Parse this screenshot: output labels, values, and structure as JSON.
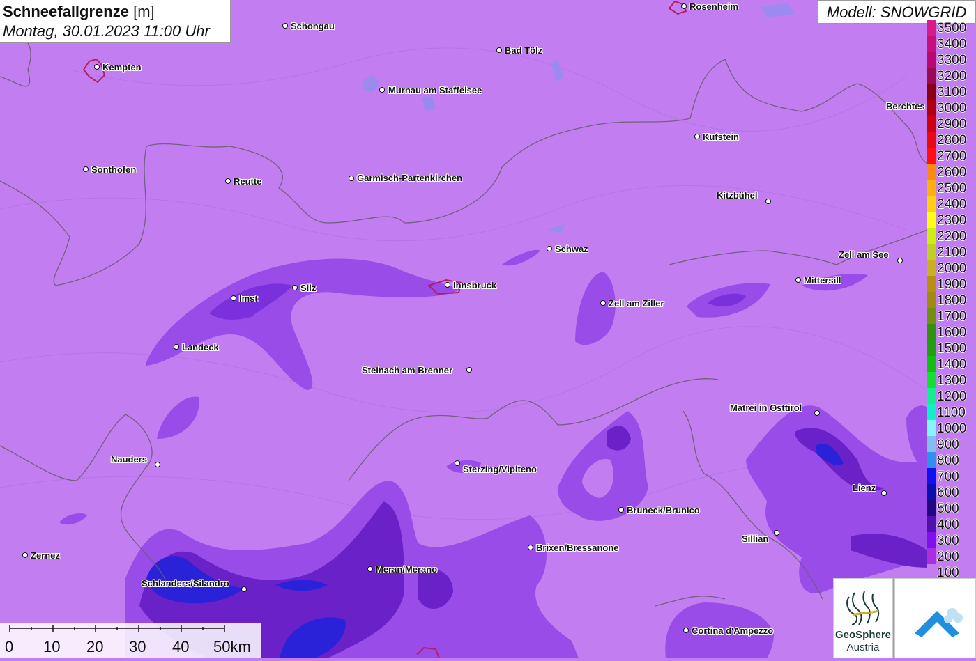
{
  "title": {
    "parameter": "Schneefallgrenze",
    "unit": "[m]",
    "datetime": "Montag, 30.01.2023 11:00 Uhr"
  },
  "model_label": "Modell: SNOWGRID",
  "cities": [
    {
      "name": "Rosenheim"
    },
    {
      "name": "Schongau"
    },
    {
      "name": "Kempten"
    },
    {
      "name": "Bad Tölz"
    },
    {
      "name": "Murnau am Staffelsee"
    },
    {
      "name": "Berchtes"
    },
    {
      "name": "Kufstein"
    },
    {
      "name": "Sonthofen"
    },
    {
      "name": "Reutte"
    },
    {
      "name": "Garmisch-Partenkirchen"
    },
    {
      "name": "Kitzbühel"
    },
    {
      "name": "Schwaz"
    },
    {
      "name": "Zell am See"
    },
    {
      "name": "Mittersill"
    },
    {
      "name": "Innsbruck"
    },
    {
      "name": "Imst"
    },
    {
      "name": "Silz"
    },
    {
      "name": "Zell am Ziller"
    },
    {
      "name": "Landeck"
    },
    {
      "name": "Steinach am Brenner"
    },
    {
      "name": "Matrei in Osttirol"
    },
    {
      "name": "Nauders"
    },
    {
      "name": "Sterzing/Vipiteno"
    },
    {
      "name": "Lienz"
    },
    {
      "name": "Bruneck/Brunico"
    },
    {
      "name": "Sillian"
    },
    {
      "name": "Brixen/Bressanone"
    },
    {
      "name": "Zernez"
    },
    {
      "name": "Meran/Merano"
    },
    {
      "name": "Schlanders/Silandro"
    },
    {
      "name": "Cortina d'Ampezzo"
    }
  ],
  "legend": [
    {
      "label": "3500",
      "color": "#d81b8a"
    },
    {
      "label": "3400",
      "color": "#c8107c"
    },
    {
      "label": "3300",
      "color": "#b80a6e"
    },
    {
      "label": "3200",
      "color": "#9a0a50"
    },
    {
      "label": "3100",
      "color": "#8a0010"
    },
    {
      "label": "3000",
      "color": "#b00010"
    },
    {
      "label": "2900",
      "color": "#d00010"
    },
    {
      "label": "2800",
      "color": "#e80a10"
    },
    {
      "label": "2700",
      "color": "#ff1010"
    },
    {
      "label": "2600",
      "color": "#ff8a10"
    },
    {
      "label": "2500",
      "color": "#ffb010"
    },
    {
      "label": "2400",
      "color": "#ffd010"
    },
    {
      "label": "2300",
      "color": "#ffff10"
    },
    {
      "label": "2200",
      "color": "#ccee10"
    },
    {
      "label": "2100",
      "color": "#c0d020"
    },
    {
      "label": "2000",
      "color": "#c8b020"
    },
    {
      "label": "1900",
      "color": "#b89010"
    },
    {
      "label": "1800",
      "color": "#a08a10"
    },
    {
      "label": "1700",
      "color": "#709010"
    },
    {
      "label": "1600",
      "color": "#309010"
    },
    {
      "label": "1500",
      "color": "#20a010"
    },
    {
      "label": "1400",
      "color": "#10c010"
    },
    {
      "label": "1300",
      "color": "#10e030"
    },
    {
      "label": "1200",
      "color": "#10f090"
    },
    {
      "label": "1100",
      "color": "#10f0c8"
    },
    {
      "label": "1000",
      "color": "#80f8f8"
    },
    {
      "label": "900",
      "color": "#80c0f0"
    },
    {
      "label": "800",
      "color": "#3090f0"
    },
    {
      "label": "700",
      "color": "#1010f0"
    },
    {
      "label": "600",
      "color": "#0a10b0"
    },
    {
      "label": "500",
      "color": "#200880"
    },
    {
      "label": "400",
      "color": "#5010b0"
    },
    {
      "label": "300",
      "color": "#8010f0"
    },
    {
      "label": "200",
      "color": "#a830e0"
    },
    {
      "label": "100",
      "color": "#c27ef0"
    }
  ],
  "scale": {
    "ticks": [
      "0",
      "10",
      "20",
      "30",
      "40"
    ],
    "last": "50km"
  },
  "logos": {
    "geosphere_line1": "GeoSphere",
    "geosphere_line2": "Austria"
  },
  "colors": {
    "base_fill": "#c27ef0",
    "mid_fill": "#8e3be8",
    "deep_fill": "#5a16b8",
    "blue_fill": "#2a22d8",
    "border": "#6a5c73",
    "city_outline": "#b0206a"
  }
}
